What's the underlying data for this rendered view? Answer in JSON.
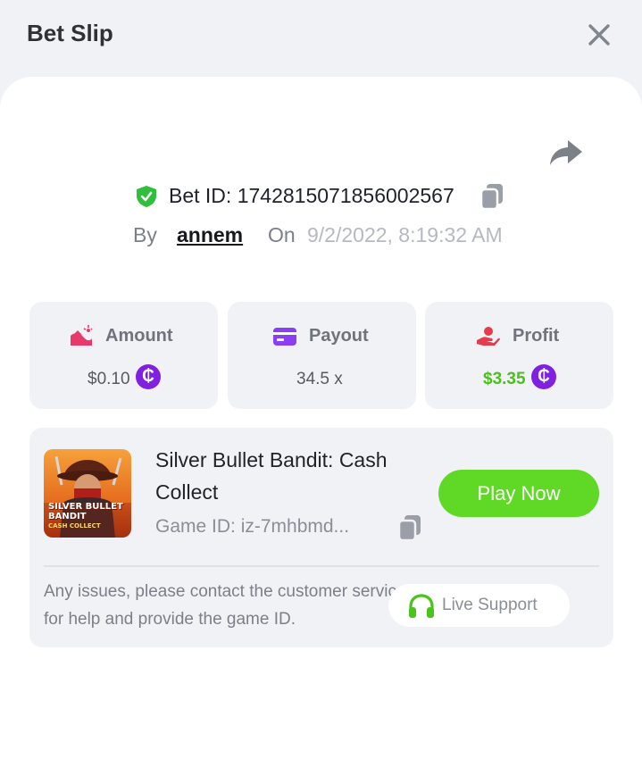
{
  "header": {
    "title": "Bet Slip"
  },
  "bet": {
    "id_label": "Bet ID: 1742815071856002567",
    "by_label": "By",
    "username": "annem",
    "on_label": "On",
    "datetime": "9/2/2022, 8:19:32 AM"
  },
  "stats": {
    "amount": {
      "label": "Amount",
      "value": "$0.10",
      "coin": "₵"
    },
    "payout": {
      "label": "Payout",
      "value": "34.5 x"
    },
    "profit": {
      "label": "Profit",
      "value": "$3.35",
      "coin": "₵"
    }
  },
  "game": {
    "title": "Silver Bullet Bandit: Cash Collect",
    "id_label": "Game ID: iz-7mhbmd...",
    "thumb_text_1": "SILVER BULLET",
    "thumb_text_2": "BANDIT",
    "thumb_text_3": "CASH COLLECT",
    "play_label": "Play Now"
  },
  "support": {
    "notice": "Any issues, please contact the customer service for help and provide the game ID.",
    "button_label": "Live Support"
  },
  "icons": {
    "close": "close-icon",
    "share": "share-icon",
    "verified": "shield-check-icon",
    "copy": "copy-icon",
    "amount": "amount-icon",
    "payout": "card-icon",
    "profit": "hand-coin-icon",
    "headset": "headset-icon"
  },
  "colors": {
    "accent_green": "#5fd925",
    "profit_green": "#4cbf1f",
    "coin_purple": "#8120e0",
    "payout_purple": "#8b3ff5",
    "amount_pink": "#e83a6a",
    "profit_red": "#e43c4c",
    "verified_green": "#2fbf3a"
  }
}
